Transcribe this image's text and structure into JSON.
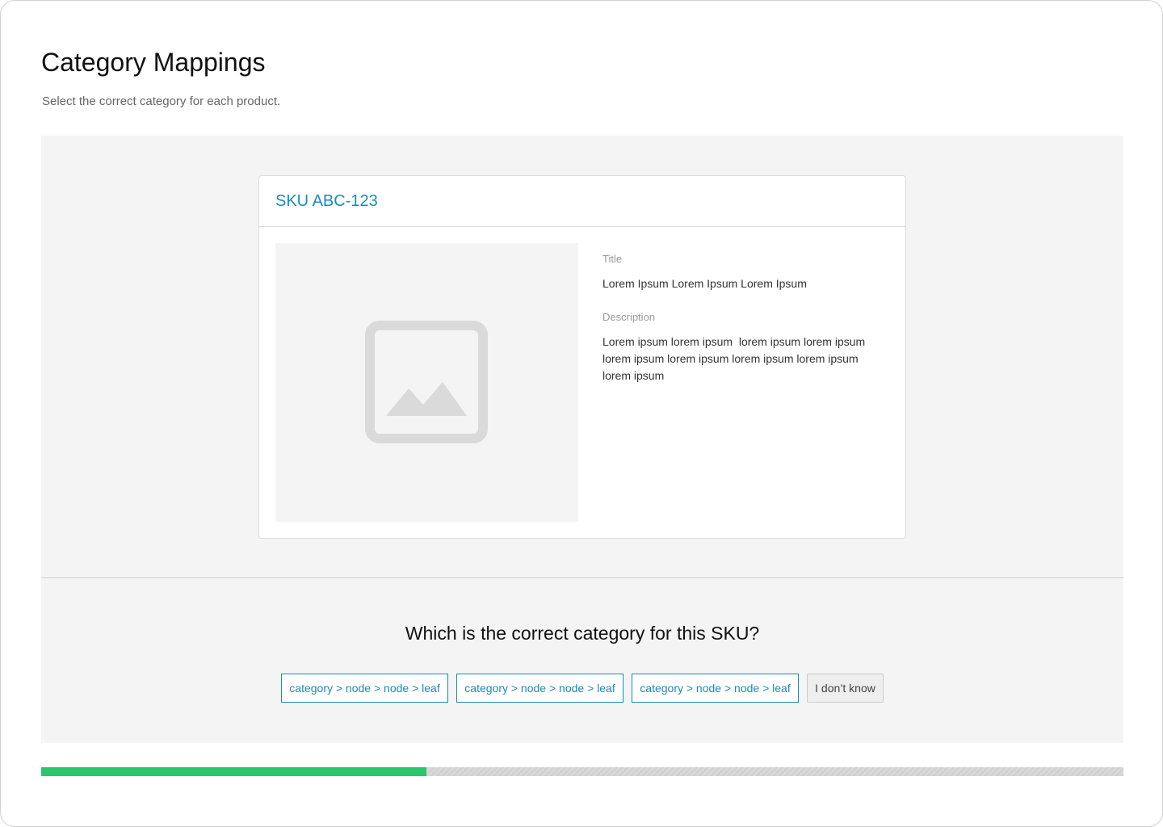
{
  "page": {
    "title": "Category Mappings",
    "subtitle": "Select the correct category for each product."
  },
  "product": {
    "sku": "SKU ABC-123",
    "image_icon": "image-placeholder-icon",
    "title_label": "Title",
    "title_value": "Lorem Ipsum Lorem Ipsum Lorem Ipsum",
    "description_label": "Description",
    "description_value": "Lorem ipsum lorem ipsum  lorem ipsum lorem ipsum lorem ipsum lorem ipsum lorem ipsum lorem ipsum lorem ipsum"
  },
  "question": {
    "text": "Which is the correct category for this SKU?",
    "options": [
      "category > node > node > leaf",
      "category > node > node > leaf",
      "category > node > node > leaf"
    ],
    "dont_know_label": "I don’t know"
  },
  "progress": {
    "fraction": 0.356
  },
  "colors": {
    "accent": "#1a8bbd",
    "progress_fill": "#2ac66c",
    "panel_background": "#f4f4f4"
  }
}
